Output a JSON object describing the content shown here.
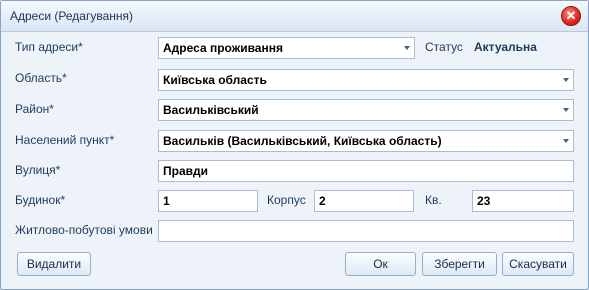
{
  "window": {
    "title": "Адреси (Редагування)"
  },
  "form": {
    "address_type": {
      "label": "Тип адреси*",
      "value": "Адреса проживання"
    },
    "status": {
      "label": "Статус",
      "value": "Актуальна"
    },
    "region": {
      "label": "Область*",
      "value": "Київська область"
    },
    "district": {
      "label": "Район*",
      "value": "Васильківський"
    },
    "locality": {
      "label": "Населений пункт*",
      "value": "Васильків (Васильківський, Київська область)"
    },
    "street": {
      "label": "Вулиця*",
      "value": "Правди"
    },
    "building": {
      "label": "Будинок*",
      "value": "1"
    },
    "block": {
      "label": "Корпус",
      "value": "2"
    },
    "apartment": {
      "label": "Кв.",
      "value": "23"
    },
    "living_conditions": {
      "label": "Житлово-побутові умови",
      "value": ""
    }
  },
  "buttons": {
    "delete": "Видалити",
    "ok": "Ок",
    "save": "Зберегти",
    "cancel": "Скасувати"
  }
}
